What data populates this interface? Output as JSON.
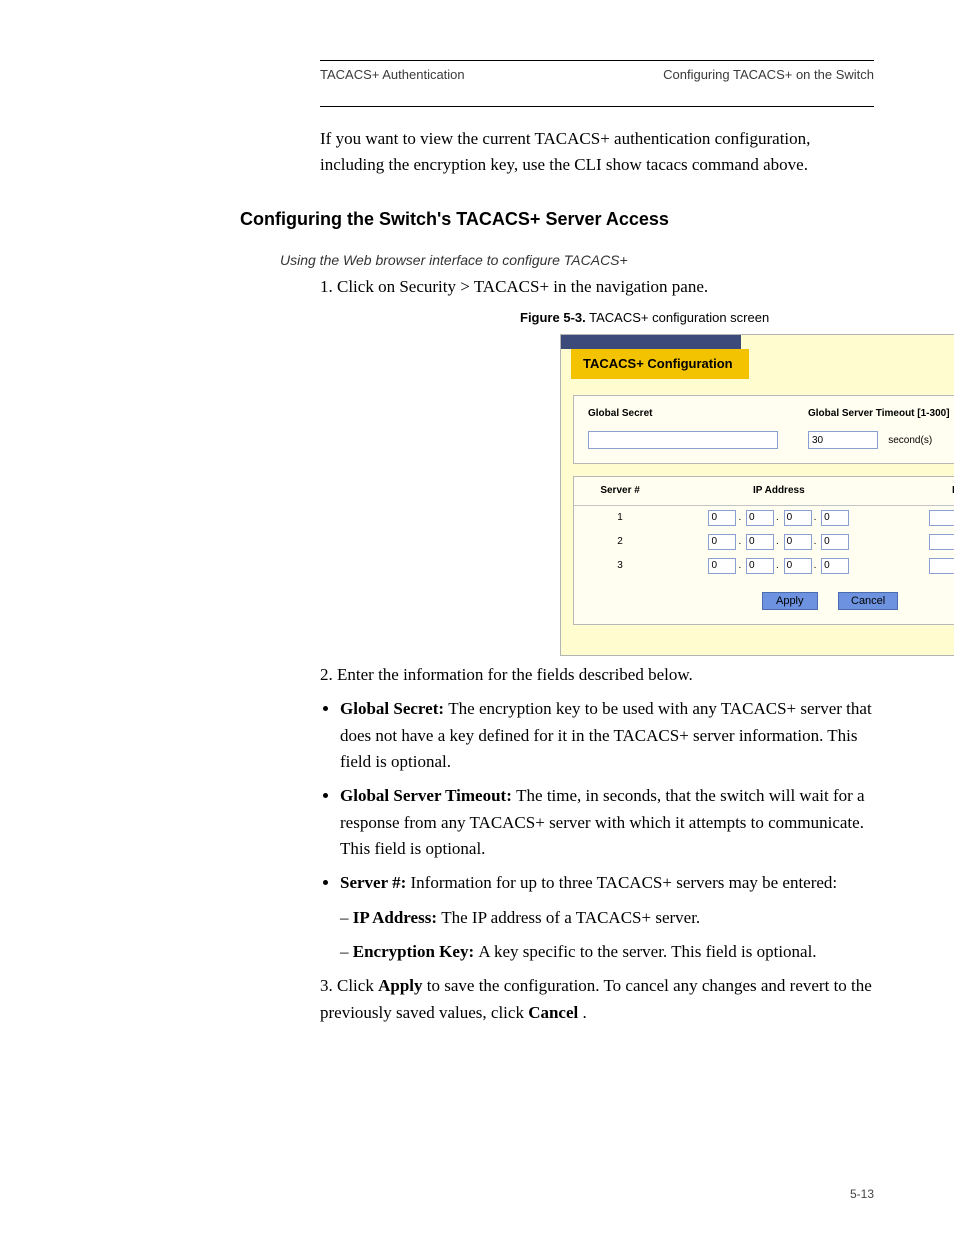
{
  "header": {
    "left": "TACACS+ Authentication",
    "right": "Configuring TACACS+ on the Switch"
  },
  "intro": "If you want to view the current TACACS+ authentication configuration, including the encryption key, use the CLI show tacacs command above.",
  "sect_title": "Configuring the Switch's TACACS+ Server Access",
  "subsect": "Using the Web browser interface to configure TACACS+",
  "step1": "1. Click on Security > TACACS+ in the navigation pane.",
  "figcap_num": "Figure 5-3.",
  "figcap_txt": "TACACS+ configuration screen",
  "panel": {
    "title": "TACACS+ Configuration",
    "global_secret_label": "Global Secret",
    "global_secret_value": "",
    "timeout_label": "Global Server Timeout [1-300]",
    "timeout_value": "30",
    "seconds": "second(s)",
    "cols": {
      "server": "Server #",
      "ip": "IP Address",
      "key": "Encryption Key"
    },
    "rows": [
      {
        "num": "1",
        "oct": [
          "0",
          "0",
          "0",
          "0"
        ],
        "key": ""
      },
      {
        "num": "2",
        "oct": [
          "0",
          "0",
          "0",
          "0"
        ],
        "key": ""
      },
      {
        "num": "3",
        "oct": [
          "0",
          "0",
          "0",
          "0"
        ],
        "key": ""
      }
    ],
    "apply": "Apply",
    "cancel": "Cancel"
  },
  "step2": "2. Enter the information for the fields described below.",
  "bullet_gs_lead": "Global Secret: ",
  "bullet_gs_body": "The encryption key to be used with any TACACS+ server that does not have a key defined for it in the TACACS+ server information. This field is optional.",
  "bullet_to_lead": "Global Server Timeout: ",
  "bullet_to_body": "The time, in seconds, that the switch will wait for a response from any TACACS+ server with which it attempts to communicate. This field is optional.",
  "bullet_srv_lead": "Server #: ",
  "bullet_srv_body": "Information for up to three TACACS+ servers may be entered:",
  "srv_ip_lead": "IP Address: ",
  "srv_ip_body": "The IP address of a TACACS+ server.",
  "srv_key_lead": "Encryption Key: ",
  "srv_key_body": "A key specific to the server. This field is optional.",
  "step3_a": "3. Click ",
  "step3_b": "Apply",
  "step3_c": " to save the configuration. To cancel any changes and revert to the previously saved values, click ",
  "step3_d": "Cancel",
  "step3_e": ".",
  "footer": {
    "left": "",
    "right": "5-13"
  }
}
